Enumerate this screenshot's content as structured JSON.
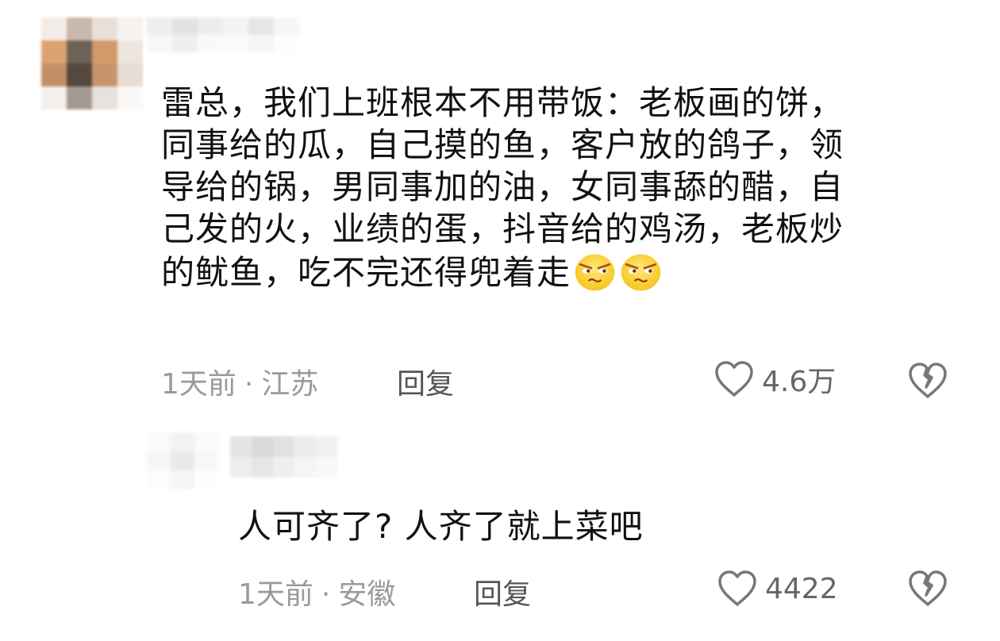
{
  "comments": [
    {
      "text": "雷总，我们上班根本不用带饭：老板画的饼，\n同事给的瓜，自己摸的鱼，客户放的鸽子，领\n导给的锅，男同事加的油，女同事舔的醋，自\n己发的火，业绩的蛋，抖音给的鸡汤，老板炒\n的鱿鱼，吃不完还得兜着走",
      "emojis": [
        "smirk-face-emoji",
        "smirk-face-emoji"
      ],
      "time": "1天前",
      "location": "江苏",
      "reply_label": "回复",
      "likes": "4.6万"
    },
    {
      "text": "人可齐了? 人齐了就上菜吧",
      "time": "1天前",
      "location": "安徽",
      "reply_label": "回复",
      "likes": "4422"
    }
  ],
  "separator": "·",
  "icons": {
    "like": "heart-outline-icon",
    "dislike": "broken-heart-icon"
  },
  "colors": {
    "text": "#111111",
    "meta": "#9a9a9a",
    "reply": "#555555",
    "icon": "#777777"
  }
}
